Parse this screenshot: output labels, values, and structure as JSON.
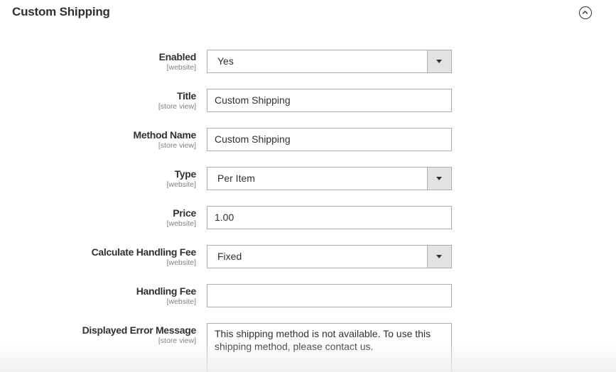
{
  "section": {
    "title": "Custom Shipping",
    "toggle_icon": "chevron-up-circle-icon"
  },
  "fields": {
    "enabled": {
      "label": "Enabled",
      "scope": "[website]",
      "value": "Yes"
    },
    "title": {
      "label": "Title",
      "scope": "[store view]",
      "value": "Custom Shipping"
    },
    "method_name": {
      "label": "Method Name",
      "scope": "[store view]",
      "value": "Custom Shipping"
    },
    "type": {
      "label": "Type",
      "scope": "[website]",
      "value": "Per Item"
    },
    "price": {
      "label": "Price",
      "scope": "[website]",
      "value": "1.00"
    },
    "handling_type": {
      "label": "Calculate Handling Fee",
      "scope": "[website]",
      "value": "Fixed"
    },
    "handling_fee": {
      "label": "Handling Fee",
      "scope": "[website]",
      "value": ""
    },
    "error_message": {
      "label": "Displayed Error Message",
      "scope": "[store view]",
      "value": "This shipping method is not available. To use this shipping method, please contact us."
    }
  }
}
